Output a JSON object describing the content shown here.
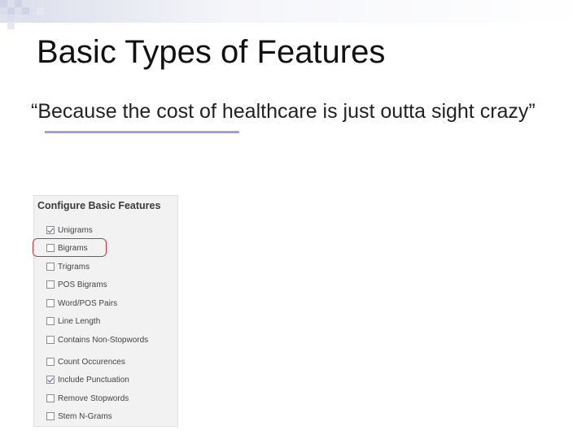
{
  "slide": {
    "title": "Basic Types of Features",
    "quote": "“Because the cost of healthcare is just outta sight crazy”"
  },
  "panel": {
    "title": "Configure Basic Features",
    "options": [
      {
        "label": "Unigrams",
        "checked": true
      },
      {
        "label": "Bigrams",
        "checked": false
      },
      {
        "label": "Trigrams",
        "checked": false
      },
      {
        "label": "POS Bigrams",
        "checked": false
      },
      {
        "label": "Word/POS Pairs",
        "checked": false
      },
      {
        "label": "Line Length",
        "checked": false
      },
      {
        "label": "Contains Non-Stopwords",
        "checked": false
      },
      {
        "label": "Count Occurences",
        "checked": false
      },
      {
        "label": "Include Punctuation",
        "checked": true
      },
      {
        "label": "Remove Stopwords",
        "checked": false
      },
      {
        "label": "Stem N-Grams",
        "checked": false
      }
    ]
  },
  "colors": {
    "accent_rule": "#9da2d6",
    "highlight": "#d0363c",
    "check": "#2b5ba8"
  }
}
